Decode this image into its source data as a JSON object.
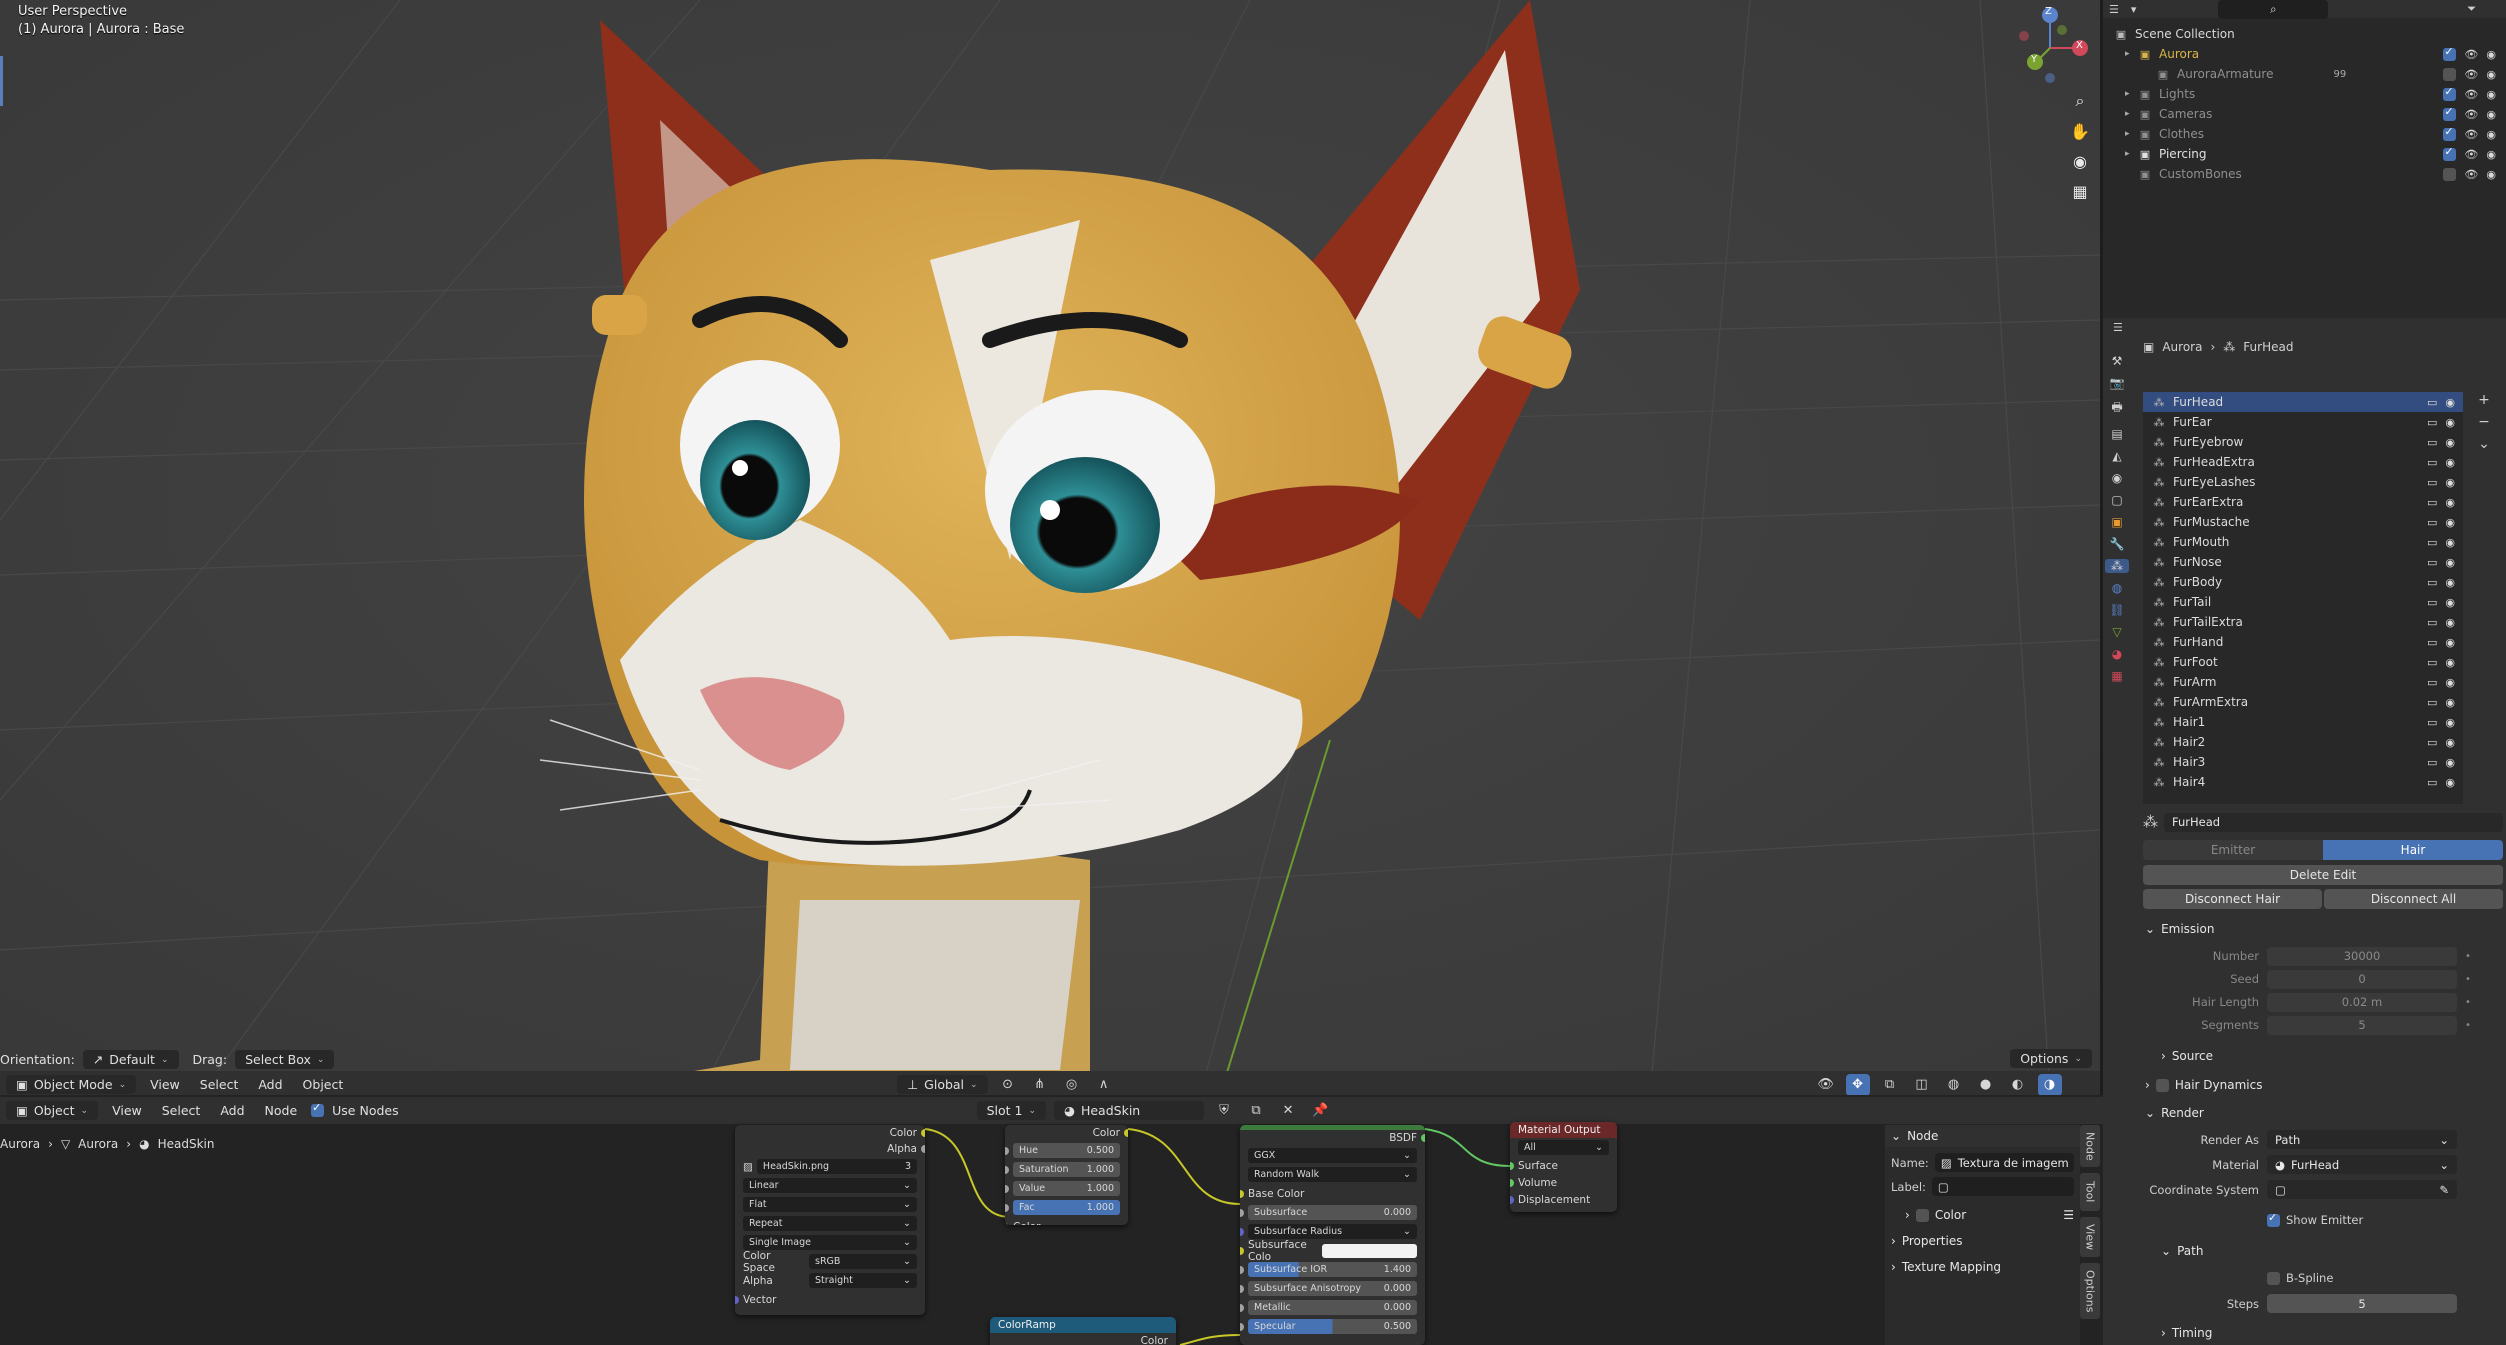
{
  "viewport": {
    "perspective_label": "User Perspective",
    "object_label": "(1) Aurora | Aurora : Base",
    "tool_header": {
      "orientation_label": "Orientation:",
      "orientation_value": "Default",
      "drag_label": "Drag:",
      "drag_value": "Select Box",
      "options_label": "Options"
    },
    "header": {
      "mode": "Object Mode",
      "menu": [
        "View",
        "Select",
        "Add",
        "Object"
      ],
      "transform": "Global"
    },
    "gizmo": {
      "axes": [
        "Z",
        "X",
        "Y"
      ]
    },
    "icons": [
      "zoom-icon",
      "hand-icon",
      "camera-icon",
      "ortho-grid-icon"
    ]
  },
  "outliner": {
    "root": "Scene Collection",
    "items": [
      {
        "label": "Aurora",
        "color": "#d9b44a",
        "checked": true,
        "depth": 0
      },
      {
        "label": "AuroraArmature",
        "color": "#8f8f8f",
        "checked": false,
        "depth": 1,
        "extra": "99"
      },
      {
        "label": "Lights",
        "color": "#8f8f8f",
        "checked": true,
        "depth": 0
      },
      {
        "label": "Cameras",
        "color": "#8f8f8f",
        "checked": true,
        "depth": 0
      },
      {
        "label": "Clothes",
        "color": "#8f8f8f",
        "checked": true,
        "depth": 0
      },
      {
        "label": "Piercing",
        "color": "#e0e0e0",
        "checked": true,
        "depth": 0
      },
      {
        "label": "CustomBones",
        "color": "#8f8f8f",
        "checked": false,
        "depth": 0
      }
    ]
  },
  "properties": {
    "breadcrumb": [
      "Aurora",
      "FurHead"
    ],
    "particle_systems": [
      "FurHead",
      "FurEar",
      "FurEyebrow",
      "FurHeadExtra",
      "FurEyeLashes",
      "FurEarExtra",
      "FurMustache",
      "FurMouth",
      "FurNose",
      "FurBody",
      "FurTail",
      "FurTailExtra",
      "FurHand",
      "FurFoot",
      "FurArm",
      "FurArmExtra",
      "Hair1",
      "Hair2",
      "Hair3",
      "Hair4"
    ],
    "settings_name": "FurHead",
    "type_tabs": [
      "Emitter",
      "Hair"
    ],
    "delete_edit": "Delete Edit",
    "disconnect_hair": "Disconnect Hair",
    "disconnect_all": "Disconnect All",
    "emission": {
      "title": "Emission",
      "fields": [
        {
          "label": "Number",
          "value": "30000"
        },
        {
          "label": "Seed",
          "value": "0"
        },
        {
          "label": "Hair Length",
          "value": "0.02 m"
        },
        {
          "label": "Segments",
          "value": "5"
        }
      ],
      "source": "Source"
    },
    "hair_dynamics": "Hair Dynamics",
    "render": {
      "title": "Render",
      "render_as_label": "Render As",
      "render_as_value": "Path",
      "material_label": "Material",
      "material_value": "FurHead",
      "coordinate_label": "Coordinate System",
      "show_emitter": "Show Emitter",
      "path_title": "Path",
      "bspline": "B-Spline",
      "steps_label": "Steps",
      "steps_value": "5",
      "timing": "Timing"
    }
  },
  "node_editor": {
    "header": {
      "object_dd": "Object",
      "menu": [
        "View",
        "Select",
        "Add",
        "Node"
      ],
      "use_nodes": "Use Nodes",
      "slot": "Slot 1",
      "material": "HeadSkin"
    },
    "breadcrumb": [
      "Aurora",
      "Aurora",
      "HeadSkin"
    ],
    "image_node": {
      "out_color": "Color",
      "out_alpha": "Alpha",
      "image_name": "HeadSkin.png",
      "users": "3",
      "interpolation": "Linear",
      "projection": "Flat",
      "extension": "Repeat",
      "source": "Single Image",
      "color_space_label": "Color Space",
      "color_space": "sRGB",
      "alpha_label": "Alpha",
      "alpha": "Straight",
      "vector": "Vector"
    },
    "hsv_node": {
      "out_color": "Color",
      "fields": [
        {
          "label": "Hue",
          "value": "0.500"
        },
        {
          "label": "Saturation",
          "value": "1.000"
        },
        {
          "label": "Value",
          "value": "1.000"
        },
        {
          "label": "Fac",
          "value": "1.000"
        }
      ],
      "in_color": "Color"
    },
    "bsdf_node": {
      "out": "BSDF",
      "distribution": "GGX",
      "subsurface_method": "Random Walk",
      "base_color": "Base Color",
      "subsurface": {
        "label": "Subsurface",
        "value": "0.000"
      },
      "subsurface_radius": "Subsurface Radius",
      "subsurface_color": "Subsurface Colo",
      "subsurface_ior": {
        "label": "Subsurface IOR",
        "value": "1.400"
      },
      "subsurface_aniso": {
        "label": "Subsurface Anisotropy",
        "value": "0.000"
      },
      "metallic": {
        "label": "Metallic",
        "value": "0.000"
      },
      "specular": {
        "label": "Specular",
        "value": "0.500"
      }
    },
    "output_node": {
      "title": "Material Output",
      "target": "All",
      "inputs": [
        "Surface",
        "Volume",
        "Displacement"
      ]
    },
    "colorramp_node": {
      "title": "ColorRamp",
      "out": "Color"
    },
    "sidebar": {
      "section": "Node",
      "name_label": "Name:",
      "name_value": "Textura de imagem",
      "label_label": "Label:",
      "color": "Color",
      "properties": "Properties",
      "texture_mapping": "Texture Mapping",
      "tabs": [
        "Node",
        "Tool",
        "View",
        "Options"
      ]
    }
  }
}
